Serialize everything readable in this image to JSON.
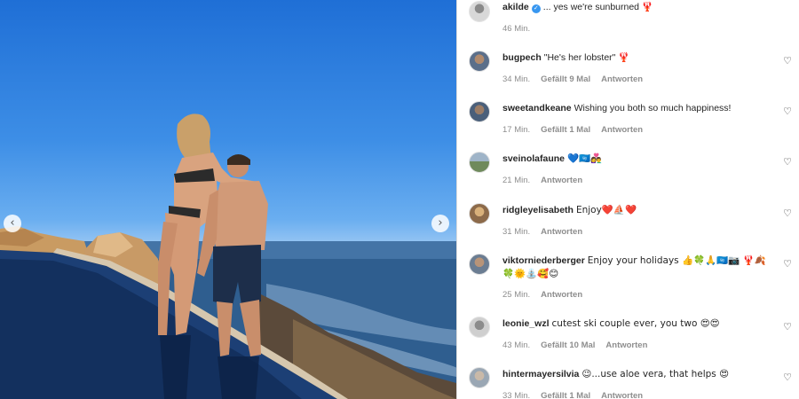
{
  "photo": {
    "alt_subject": "couple-at-infinity-pool",
    "prev_icon": "chevron-left-icon",
    "next_icon": "chevron-right-icon"
  },
  "comments": [
    {
      "username": "akilde",
      "verified": true,
      "text": "... yes we're sunburned 🦞",
      "time": "46 Min.",
      "likes": "",
      "reply": "",
      "heart": false
    },
    {
      "username": "bugpech",
      "verified": false,
      "text": "\"He's her lobster\" 🦞",
      "time": "34 Min.",
      "likes": "Gefällt 9 Mal",
      "reply": "Antworten",
      "heart": true
    },
    {
      "username": "sweetandkeane",
      "verified": false,
      "text": "Wishing you both so much happiness!",
      "time": "17 Min.",
      "likes": "Gefällt 1 Mal",
      "reply": "Antworten",
      "heart": true
    },
    {
      "username": "sveinolafaune",
      "verified": false,
      "text": "💙🇺🇳👩‍❤️‍👨",
      "time": "21 Min.",
      "likes": "",
      "reply": "Antworten",
      "heart": true
    },
    {
      "username": "ridgleyelisabeth",
      "verified": false,
      "text": "Enjoy❤️⛵❤️",
      "time": "31 Min.",
      "likes": "",
      "reply": "Antworten",
      "heart": true
    },
    {
      "username": "viktorniederberger",
      "verified": false,
      "text": "Enjoy your holidays 👍🍀🙏🇺🇳📷 🦞🍂🍀🌞⛲🥰😊",
      "time": "25 Min.",
      "likes": "",
      "reply": "Antworten",
      "heart": true
    },
    {
      "username": "leonie_wzl",
      "verified": false,
      "text": "cutest ski couple ever, you two 😍😍",
      "time": "43 Min.",
      "likes": "Gefällt 10 Mal",
      "reply": "Antworten",
      "heart": true
    },
    {
      "username": "hintermayersilvia",
      "verified": false,
      "text": "😉...use aloe vera, that helps 😍",
      "time": "33 Min.",
      "likes": "Gefällt 1 Mal",
      "reply": "Antworten",
      "heart": true
    }
  ],
  "colors": {
    "accent": "#3897f0",
    "muted": "#8e8e8e",
    "text": "#262626"
  }
}
